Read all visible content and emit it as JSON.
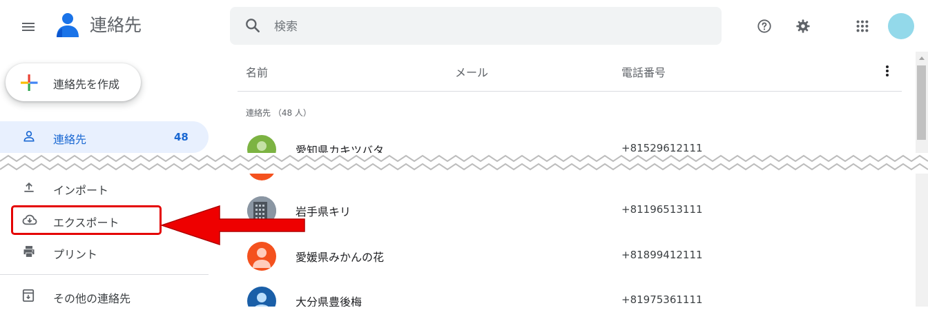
{
  "header": {
    "app_title": "連絡先",
    "search_placeholder": "検索",
    "icons": [
      "menu-icon",
      "help-icon",
      "settings-icon",
      "apps-grid-icon"
    ],
    "avatar_color": "#93d9ea"
  },
  "sidebar": {
    "create_label": "連絡先を作成",
    "active_item": {
      "label": "連絡先",
      "count": "48"
    },
    "items": [
      {
        "label": "インポート",
        "icon": "upload-icon"
      },
      {
        "label": "エクスポート",
        "icon": "cloud-download-icon"
      },
      {
        "label": "プリント",
        "icon": "printer-icon"
      },
      {
        "label": "その他の連絡先",
        "icon": "archive-icon"
      }
    ]
  },
  "main": {
    "columns": [
      "名前",
      "メール",
      "電話番号"
    ],
    "section_label": "連絡先 （48 人）",
    "contacts": [
      {
        "name": "愛知県カキツバタ",
        "phone": "+81529612111",
        "avatar_color": "#7cb342"
      },
      {
        "name": "岩手県キリ",
        "phone": "+81196513111",
        "avatar_color": "#5b6670"
      },
      {
        "name": "愛媛県みかんの花",
        "phone": "+81899412111",
        "avatar_color": "#f4511e"
      },
      {
        "name": "大分県豊後梅",
        "phone": "+81975361111",
        "avatar_color": "#1a5fa8"
      }
    ]
  },
  "annotation": {
    "highlight_color": "#e40000",
    "arrow_color": "#ee0000"
  }
}
